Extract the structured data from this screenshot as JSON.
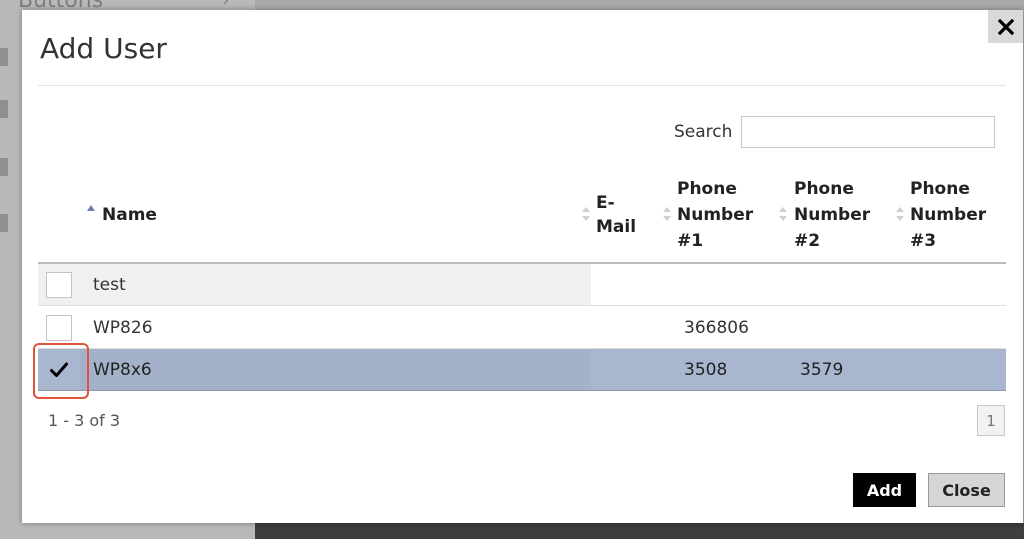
{
  "background": {
    "section_title": "Buttons"
  },
  "dialog": {
    "title": "Add User",
    "close_icon": "close-x-icon",
    "search": {
      "label": "Search",
      "value": "",
      "placeholder": ""
    },
    "table": {
      "columns": [
        {
          "label": "Name",
          "sorted": "ascending"
        },
        {
          "label": "E-Mail",
          "lines": [
            "E-",
            "Mail"
          ]
        },
        {
          "label": "Phone Number #1",
          "lines": [
            "Phone",
            "Number",
            "#1"
          ]
        },
        {
          "label": "Phone Number #2",
          "lines": [
            "Phone",
            "Number",
            "#2"
          ]
        },
        {
          "label": "Phone Number #3",
          "lines": [
            "Phone",
            "Number",
            "#3"
          ]
        }
      ],
      "rows": [
        {
          "checked": false,
          "name": "test",
          "email": "",
          "phone1": "",
          "phone2": "",
          "phone3": ""
        },
        {
          "checked": false,
          "name": "WP826",
          "email": "",
          "phone1": "366806",
          "phone2": "",
          "phone3": ""
        },
        {
          "checked": true,
          "name": "WP8x6",
          "email": "",
          "phone1": "3508",
          "phone2": "3579",
          "phone3": ""
        }
      ]
    },
    "pager": {
      "info": "1 - 3 of 3",
      "current_page": "1"
    },
    "buttons": {
      "add_label": "Add",
      "close_label": "Close"
    },
    "colors": {
      "selected_row": "#a8b6cf",
      "primary_button": "#000000",
      "highlight_outline": "#e0533b"
    }
  }
}
